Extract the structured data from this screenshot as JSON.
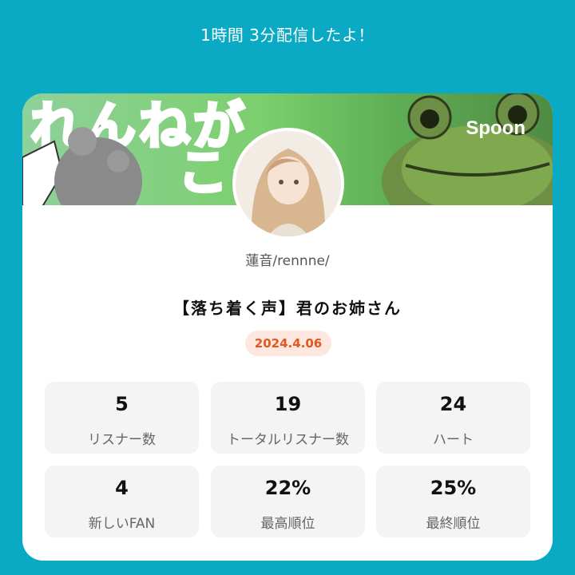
{
  "header": {
    "headline": "1時間 3分配信したよ！"
  },
  "card": {
    "brand": "Spoon",
    "host_name": "蓮音/rennne/",
    "title": "【落ち着く声】君のお姉さん",
    "date": "2024.4.06",
    "stats": [
      {
        "value": "5",
        "label": "リスナー数"
      },
      {
        "value": "19",
        "label": "トータルリスナー数"
      },
      {
        "value": "24",
        "label": "ハート"
      },
      {
        "value": "4",
        "label": "新しいFAN"
      },
      {
        "value": "22%",
        "label": "最高順位"
      },
      {
        "value": "25%",
        "label": "最終順位"
      }
    ]
  },
  "colors": {
    "background": "#0aa9c4",
    "badge_bg": "#fde7df",
    "badge_text": "#e2561f"
  }
}
